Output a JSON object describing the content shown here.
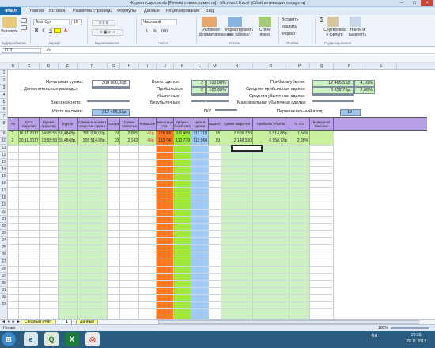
{
  "window": {
    "title": "Журнал сделок.xls [Режим совместимости] - Microsoft Excel (Сбой активации продукта)"
  },
  "tabs": [
    "Файл",
    "Главная",
    "Вставка",
    "Разметка страницы",
    "Формулы",
    "Данные",
    "Рецензирование",
    "Вид"
  ],
  "ribbon": {
    "paste": "Вставить",
    "font_name": "Arial Cyr",
    "font_size": "10",
    "number_format": "Числовой",
    "percent": "%",
    "thousands": "000",
    "cond_format": "Условное форматирование",
    "table_format": "Форматировать как таблицу",
    "cell_styles": "Стили ячеек",
    "insert": "Вставить",
    "delete": "Удалить",
    "format": "Формат",
    "sum": "Σ",
    "sort": "Сортировка и фильтр",
    "find": "Найти и выделить",
    "groups": [
      "Буфер обмена",
      "Шрифт",
      "Выравнивание",
      "Число",
      "Стили",
      "Ячейки",
      "Редактирование"
    ]
  },
  "formula_bar": {
    "name_box": "O12",
    "fx": "fx",
    "value": ""
  },
  "columns": [
    "B",
    "C",
    "D",
    "E",
    "F",
    "G",
    "H",
    "I",
    "J",
    "K",
    "L",
    "M",
    "N",
    "O",
    "P",
    "Q",
    "R",
    "S"
  ],
  "rows": [
    "1",
    "2",
    "3",
    "4",
    "5",
    "6",
    "7",
    "8",
    "9",
    "10",
    "11",
    "12",
    "13",
    "14",
    "15",
    "16",
    "17",
    "18",
    "19",
    "20",
    "21",
    "22",
    "23",
    "24",
    "25",
    "26",
    "27",
    "28",
    "29",
    "30",
    "31",
    "32",
    "33"
  ],
  "summary": {
    "start_sum_label": "Начальная сумма:",
    "start_sum": "300 000,00р.",
    "extra_costs_label": "Дополнительные расходы:",
    "deposited_label": "Внесено/снято:",
    "total_label": "Итого на счёте:",
    "total": "312 465,51р.",
    "all_trades_label": "Всего сделок:",
    "all_trades": "2",
    "all_trades_pct": "100,00%",
    "profitable_label": "Прибыльных:",
    "profitable": "2",
    "profitable_pct": "100,00%",
    "losing_label": "Убыточных:",
    "breakeven_label": "Безубыточных:",
    "pu_label": "П/У",
    "profit_loss_label": "Прибыль/убыток:",
    "profit_loss": "12 465,51р.",
    "profit_loss_pct": "4,16%",
    "avg_profit_label": "Средняя прибыльная сделка:",
    "avg_profit": "6 232,76р.",
    "avg_profit_pct": "2,08%",
    "avg_loss_label": "Средняя убыточная сделка:",
    "max_loss_label": "Максимальная убыточная сделка:",
    "first_entry_label": "Первоначальный вход:",
    "first_entry": "19"
  },
  "table_headers": [
    "№",
    "Дата открытия",
    "Время открытия",
    "Курс $",
    "Сумма на момент открытия сделки",
    "Позиции",
    "Сумма открытия",
    "Комиссия",
    "Инвестиции стоп",
    "Уровень безубытка",
    "Цель в сделке",
    "Закрыто",
    "Сумма закрытия",
    "Прибыль/ Убыток",
    "% П/У",
    "Выведено/ Внесено"
  ],
  "trades": [
    {
      "n": "1",
      "date": "16.11.2017",
      "time": "14:05:55",
      "rate": "59,4848р.",
      "sum_open": "300 000,00р.",
      "pos": "19",
      "open_amt": "2 005 030",
      "fee": "41р.",
      "inv_stop": "109 300",
      "breakeven": "111 489",
      "target": "111 710",
      "closed": "18",
      "close_amt": "2 009 720",
      "pl": "5 514,88р.",
      "pl_pct": "1,84%"
    },
    {
      "n": "2",
      "date": "20.11.2017",
      "time": "13:58:59",
      "rate": "59,4848р.",
      "sum_open": "305 514,88р.",
      "pos": "19",
      "open_amt": "2 142 430",
      "fee": "48р.",
      "inv_stop": "110 740",
      "breakeven": "112 779",
      "target": "113 060",
      "closed": "19",
      "close_amt": "2 148 330",
      "pl": "6 950,73р.",
      "pl_pct": "2,28%"
    }
  ],
  "sheets": [
    "Сводный отчёт",
    "1",
    "Данные"
  ],
  "status": {
    "ready": "Готово",
    "zoom": "100%"
  },
  "taskbar": {
    "time": "20:23",
    "date": "20.11.2017",
    "lang": "RU"
  },
  "colors": {
    "header_purple": "#b8a0e6",
    "green_row": "#c8f0a0",
    "light_green": "#ccf0c4",
    "orange": "#ff7a22",
    "lime": "#9ee83a",
    "blue": "#9ecbf6",
    "blue_box": "#9fc6ee"
  }
}
